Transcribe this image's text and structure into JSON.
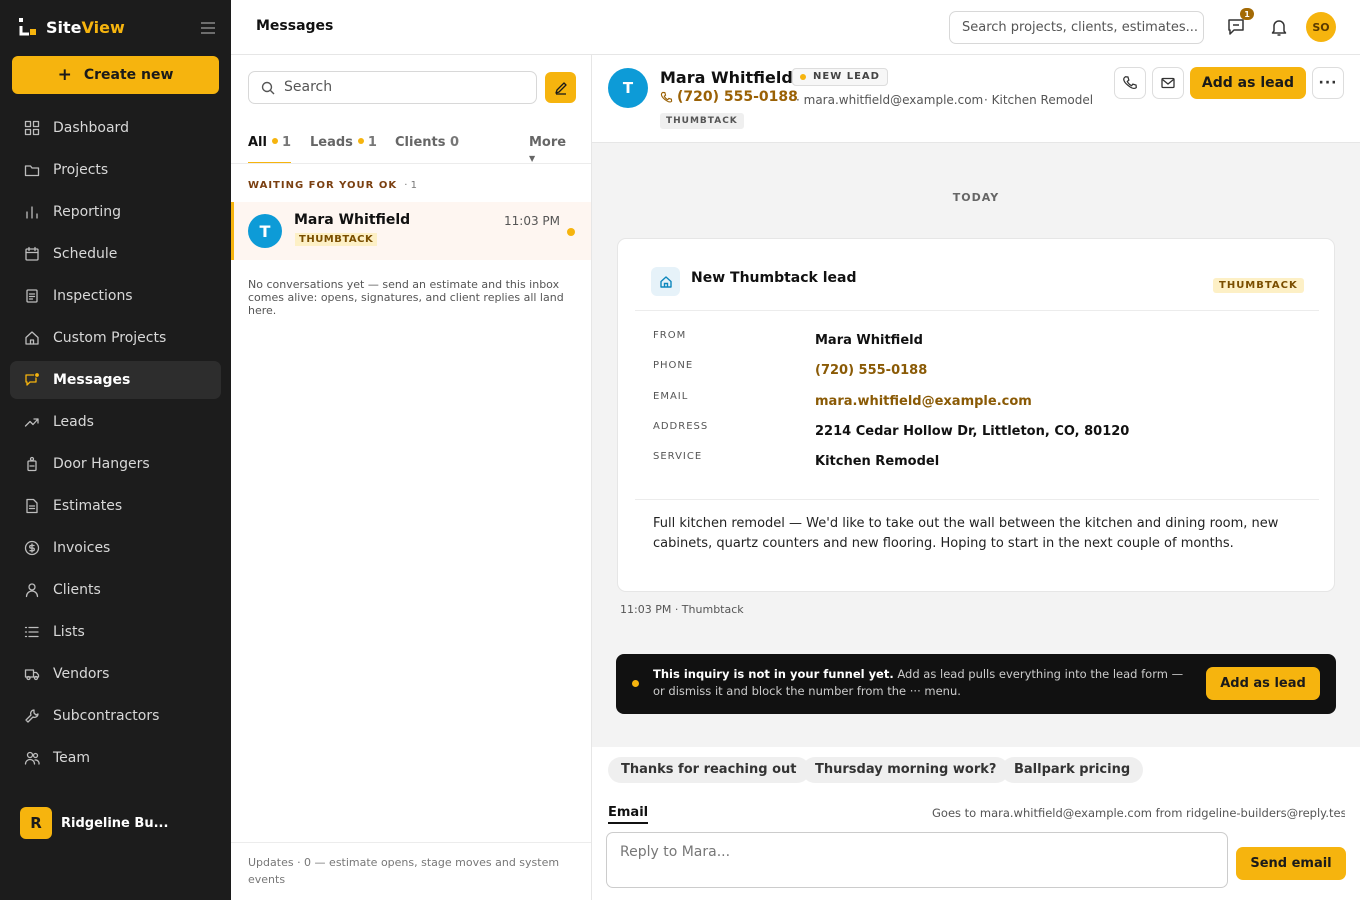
{
  "app": {
    "name_part1": "Site",
    "name_part2": "View",
    "create_label": "Create new"
  },
  "sidebar": {
    "items": [
      {
        "label": "Dashboard",
        "icon": "grid-icon"
      },
      {
        "label": "Projects",
        "icon": "folder-icon"
      },
      {
        "label": "Reporting",
        "icon": "bar-chart-icon"
      },
      {
        "label": "Schedule",
        "icon": "calendar-icon"
      },
      {
        "label": "Inspections",
        "icon": "clipboard-icon"
      },
      {
        "label": "Custom Projects",
        "icon": "house-icon"
      },
      {
        "label": "Messages",
        "icon": "chat-icon",
        "active": true
      },
      {
        "label": "Leads",
        "icon": "trend-icon"
      },
      {
        "label": "Door Hangers",
        "icon": "door-hanger-icon"
      },
      {
        "label": "Estimates",
        "icon": "document-icon"
      },
      {
        "label": "Invoices",
        "icon": "dollar-icon"
      },
      {
        "label": "Clients",
        "icon": "person-icon"
      },
      {
        "label": "Lists",
        "icon": "list-icon"
      },
      {
        "label": "Vendors",
        "icon": "truck-icon"
      },
      {
        "label": "Subcontractors",
        "icon": "wrench-icon"
      },
      {
        "label": "Team",
        "icon": "team-icon"
      }
    ],
    "org": {
      "initial": "R",
      "name": "Ridgeline Bu..."
    }
  },
  "header": {
    "title": "Messages",
    "search_placeholder": "Search projects, clients, estimates...",
    "chat_badge": "1",
    "user_initials": "SO"
  },
  "inbox": {
    "search_placeholder": "Search",
    "tabs": [
      {
        "label": "All",
        "count": "1",
        "dot": true,
        "active": true
      },
      {
        "label": "Leads",
        "count": "1",
        "dot": true
      },
      {
        "label": "Clients",
        "count": "0",
        "dot": false
      }
    ],
    "more_label": "More",
    "section_label": "WAITING FOR YOUR OK",
    "section_count": "1",
    "conversation": {
      "initial": "T",
      "name": "Mara Whitfield",
      "source": "THUMBTACK",
      "time": "11:03 PM"
    },
    "empty_note": "No conversations yet — send an estimate and this inbox comes alive: opens, signatures, and client replies all land here.",
    "updates": "Updates · 0 — estimate opens, stage moves and system events"
  },
  "thread": {
    "contact": {
      "initial": "T",
      "name": "Mara Whitfield",
      "status": "NEW LEAD",
      "phone": "(720) 555-0188",
      "email": "mara.whitfield@example.com",
      "service": "Kitchen Remodel",
      "source": "THUMBTACK"
    },
    "add_lead_label": "Add as lead",
    "day_label": "TODAY",
    "card": {
      "title": "New Thumbtack lead",
      "tag": "THUMBTACK",
      "fields": [
        {
          "label": "FROM",
          "value": "Mara Whitfield",
          "link": false
        },
        {
          "label": "PHONE",
          "value": "(720) 555-0188",
          "link": true
        },
        {
          "label": "EMAIL",
          "value": "mara.whitfield@example.com",
          "link": true
        },
        {
          "label": "ADDRESS",
          "value": "2214 Cedar Hollow Dr, Littleton, CO, 80120",
          "link": false
        },
        {
          "label": "SERVICE",
          "value": "Kitchen Remodel",
          "link": false
        }
      ],
      "body": "Full kitchen remodel — We'd like to take out the wall between the kitchen and dining room, new cabinets, quartz counters and new flooring. Hoping to start in the next couple of months.",
      "footer": "11:03 PM · Thumbtack"
    },
    "banner": {
      "bold": "This inquiry is not in your funnel yet.",
      "text": " Add as lead pulls everything into the lead form — or dismiss it and block the number from the ··· menu.",
      "button": "Add as lead"
    },
    "quick_replies": [
      "Thanks for reaching out",
      "Thursday morning work?",
      "Ballpark pricing"
    ],
    "composer": {
      "channel": "Email",
      "goes_to": "Goes to mara.whitfield@example.com from ridgeline-builders@reply.test...",
      "placeholder": "Reply to Mara...",
      "send_label": "Send email"
    }
  },
  "colors": {
    "accent": "#f6b40e",
    "sidebar": "#1c1c1c",
    "thumbtack": "#0d9bd7",
    "link": "#8a5a05"
  }
}
